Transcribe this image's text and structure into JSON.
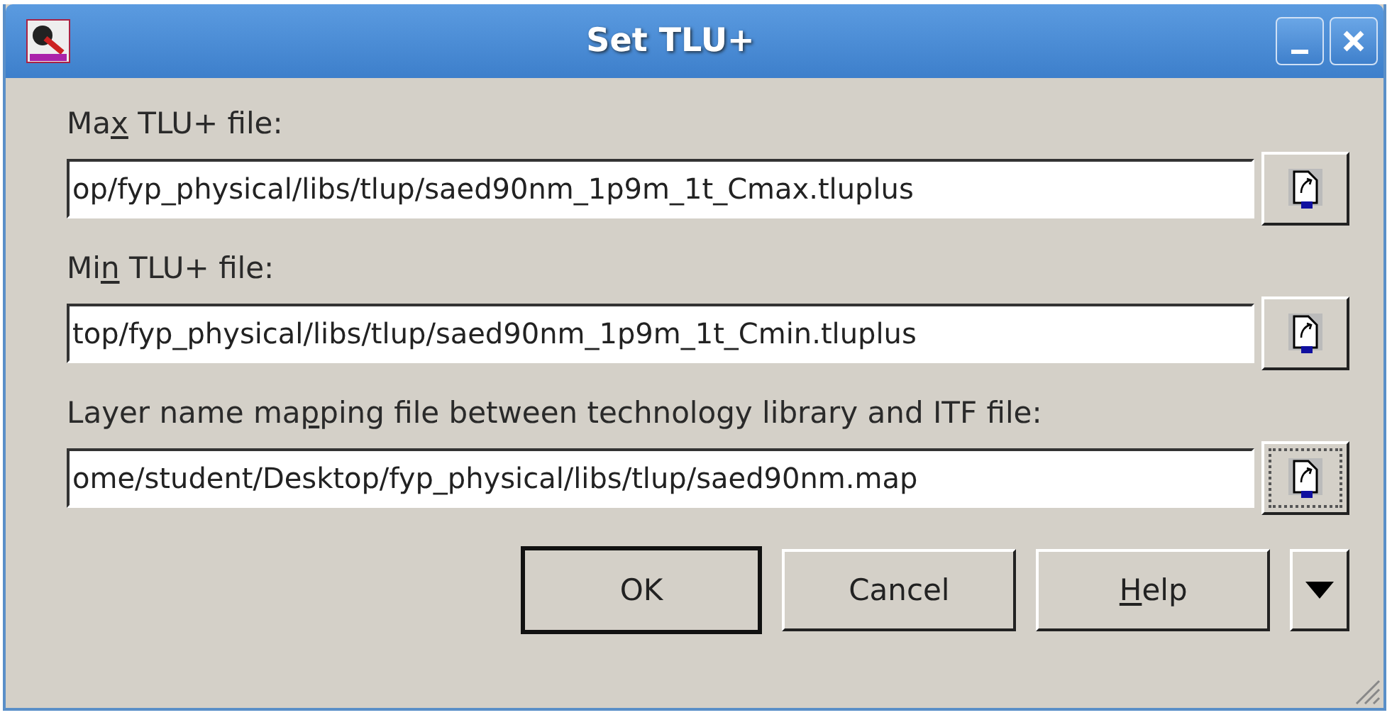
{
  "window": {
    "title": "Set TLU+"
  },
  "fields": [
    {
      "label": {
        "pre": "Ma",
        "key": "x",
        "post": " TLU+ file:"
      },
      "value": "op/fyp_physical/libs/tlup/saed90nm_1p9m_1t_Cmax.tluplus",
      "browse_focused": false
    },
    {
      "label": {
        "pre": "Mi",
        "key": "n",
        "post": " TLU+ file:"
      },
      "value": "top/fyp_physical/libs/tlup/saed90nm_1p9m_1t_Cmin.tluplus",
      "browse_focused": false
    },
    {
      "label": {
        "pre": "Layer name ma",
        "key": "p",
        "post": "ping file between technology library and ITF file:"
      },
      "value": "ome/student/Desktop/fyp_physical/libs/tlup/saed90nm.map",
      "browse_focused": true
    }
  ],
  "buttons": [
    {
      "label": {
        "pre": "OK"
      },
      "default": true
    },
    {
      "label": {
        "pre": "Cancel"
      },
      "default": false
    },
    {
      "label": {
        "key": "H",
        "post": "elp"
      },
      "default": false
    }
  ]
}
